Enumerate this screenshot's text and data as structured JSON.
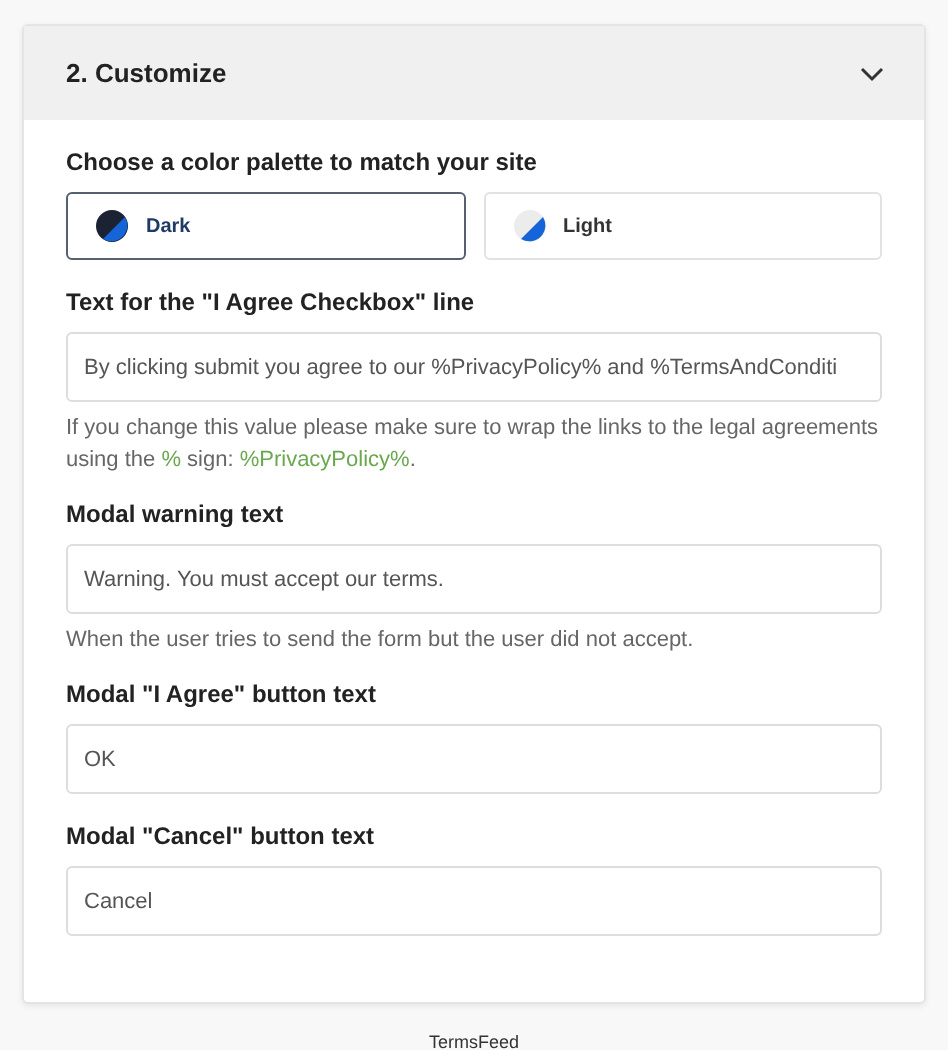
{
  "section": {
    "title": "2. Customize",
    "expanded": true
  },
  "palette": {
    "label": "Choose a color palette to match your site",
    "options": [
      {
        "label": "Dark",
        "kind": "dark",
        "selected": true
      },
      {
        "label": "Light",
        "kind": "light",
        "selected": false
      }
    ]
  },
  "fields": [
    {
      "label": "Text for the \"I Agree Checkbox\" line",
      "value": "By clicking submit you agree to our %PrivacyPolicy% and %TermsAndConditi",
      "help": [
        {
          "text": "If you change this value please make sure to wrap the links to the legal agreements using the ",
          "highlight": false
        },
        {
          "text": "%",
          "highlight": true
        },
        {
          "text": " sign: ",
          "highlight": false
        },
        {
          "text": "%PrivacyPolicy%",
          "highlight": true
        },
        {
          "text": ".",
          "highlight": false
        }
      ]
    },
    {
      "label": "Modal warning text",
      "value": "Warning. You must accept our terms.",
      "help": [
        {
          "text": "When the user tries to send the form but the user did not accept.",
          "highlight": false
        }
      ]
    },
    {
      "label": "Modal \"I Agree\" button text",
      "value": "OK"
    },
    {
      "label": "Modal \"Cancel\" button text",
      "value": "Cancel"
    }
  ],
  "footer": "TermsFeed"
}
